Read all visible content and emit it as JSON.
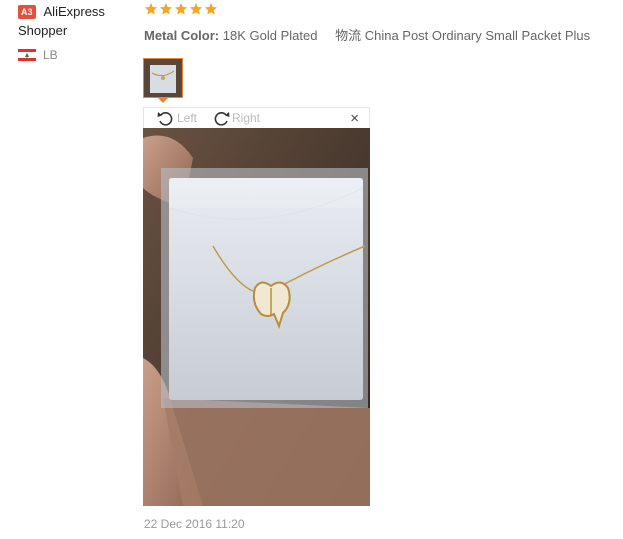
{
  "buyer": {
    "level_badge": "A3",
    "name_line1": "AliExpress",
    "name_line2": "Shopper",
    "country_code": "LB",
    "flag_icon": "lebanon-flag-icon"
  },
  "feedback": {
    "rating_stars": 5,
    "star_color": "#f5a623",
    "metal_color_label": "Metal Color:",
    "metal_color_value": "18K Gold Plated",
    "shipping_label": "物流",
    "shipping_value": "China Post Ordinary Small Packet Plus",
    "date": "22 Dec 2016 11:20"
  },
  "viewer": {
    "rotate_left_label": "Left",
    "rotate_right_label": "Right",
    "close_label": "×",
    "accent_color": "#e8833a"
  }
}
